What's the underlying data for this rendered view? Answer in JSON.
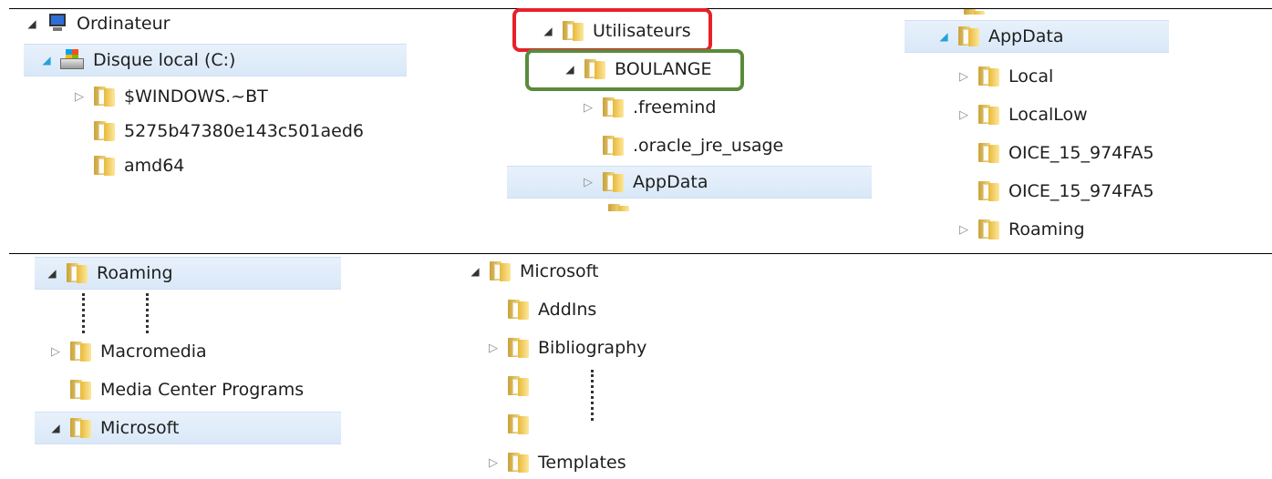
{
  "panel1": {
    "computer_label": "Ordinateur",
    "drive_label": "Disque local (C:)",
    "items": [
      "$WINDOWS.~BT",
      "5275b47380e143c501aed6",
      "amd64"
    ]
  },
  "panel2": {
    "users_label": "Utilisateurs",
    "user_label": "BOULANGE",
    "items": [
      ".freemind",
      ".oracle_jre_usage",
      "AppData"
    ]
  },
  "panel3": {
    "root_label": "AppData",
    "items": [
      "Local",
      "LocalLow",
      "OICE_15_974FA5",
      "OICE_15_974FA5",
      "Roaming"
    ]
  },
  "panel4": {
    "root_label": "Roaming",
    "items": [
      "Macromedia",
      "Media Center Programs",
      "Microsoft"
    ]
  },
  "panel5": {
    "root_label": "Microsoft",
    "items": [
      "AddIns",
      "Bibliography",
      "",
      "",
      "Templates"
    ]
  },
  "colors": {
    "selection": "#d9e8f8",
    "highlight_red": "#e8202a",
    "highlight_green": "#5a8a3a",
    "folder": "#e8b93b"
  }
}
